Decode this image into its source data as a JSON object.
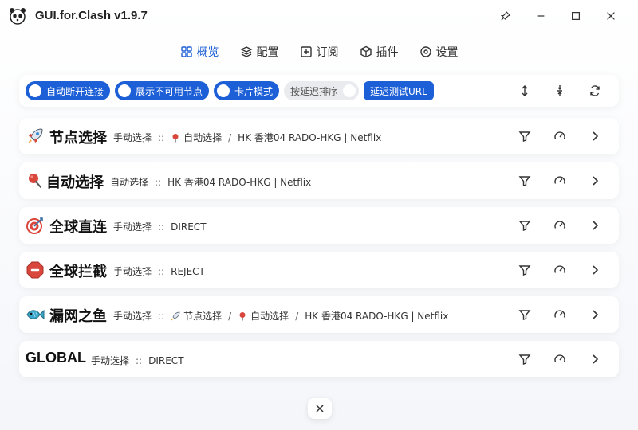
{
  "app": {
    "title": "GUI.for.Clash v1.9.7"
  },
  "nav": [
    {
      "label": "概览",
      "icon": "grid-icon",
      "active": true
    },
    {
      "label": "配置",
      "icon": "layers-icon",
      "active": false
    },
    {
      "label": "订阅",
      "icon": "subscribe-icon",
      "active": false
    },
    {
      "label": "插件",
      "icon": "cube-icon",
      "active": false
    },
    {
      "label": "设置",
      "icon": "gear-icon",
      "active": false
    }
  ],
  "toolbar": {
    "switch_auto_disconnect": "自动断开连接",
    "switch_show_unavailable": "展示不可用节点",
    "switch_card_mode": "卡片模式",
    "switch_sort_by_latency": "按延迟排序",
    "latency_test_url": "延迟测试URL"
  },
  "groups": [
    {
      "name": "节点选择",
      "emoji": "rocket-icon",
      "path": [
        "手动选择",
        "::",
        "自动选择",
        "/",
        "HK 香港04 RADO-HKG | Netflix"
      ]
    },
    {
      "name": "自动选择",
      "emoji": "pin-icon",
      "path": [
        "自动选择",
        "::",
        "HK 香港04 RADO-HKG | Netflix"
      ]
    },
    {
      "name": "全球直连",
      "emoji": "target-icon",
      "path": [
        "手动选择",
        "::",
        "DIRECT"
      ]
    },
    {
      "name": "全球拦截",
      "emoji": "stop-icon",
      "path": [
        "手动选择",
        "::",
        "REJECT"
      ]
    },
    {
      "name": "漏网之鱼",
      "emoji": "fish-icon",
      "path": [
        "手动选择",
        "::",
        "节点选择",
        "/",
        "自动选择",
        "/",
        "HK 香港04 RADO-HKG | Netflix"
      ]
    },
    {
      "name": "GLOBAL",
      "emoji": "",
      "path": [
        "手动选择",
        "::",
        "DIRECT"
      ]
    }
  ],
  "colors": {
    "accent": "#1d5fd6"
  }
}
